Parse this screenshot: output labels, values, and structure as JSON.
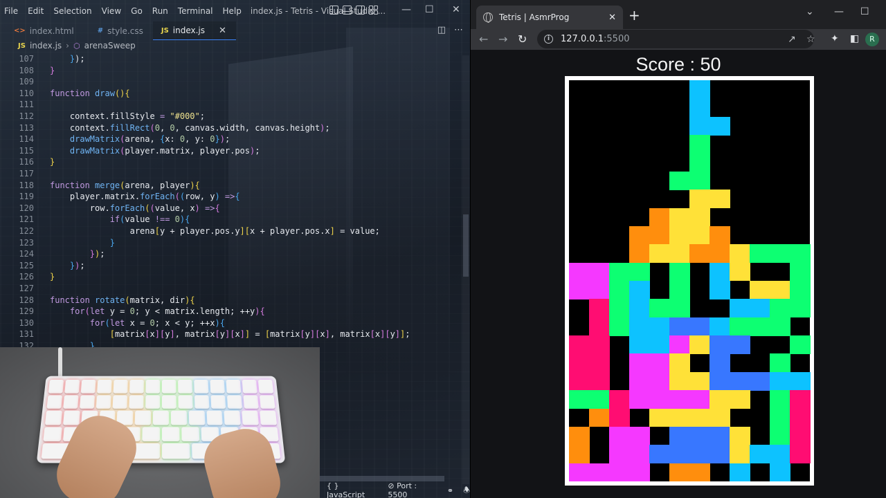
{
  "vscode": {
    "menu": [
      "File",
      "Edit",
      "Selection",
      "View",
      "Go",
      "Run",
      "Terminal",
      "Help"
    ],
    "window_title": "index.js - Tetris - Visual Studio ...",
    "tabs": [
      {
        "label": "index.html",
        "icon": "html-icon",
        "active": false
      },
      {
        "label": "style.css",
        "icon": "css-icon",
        "active": false
      },
      {
        "label": "index.js",
        "icon": "js-icon",
        "active": true
      }
    ],
    "breadcrumb": {
      "file": "index.js",
      "symbol": "arenaSweep"
    },
    "code_lines": [
      {
        "n": "107",
        "t": [
          [
            "i4",
            ""
          ],
          [
            "br3",
            "}"
          ],
          [
            "id",
            ");"
          ]
        ]
      },
      {
        "n": "108",
        "t": [
          [
            "br2",
            "}"
          ]
        ]
      },
      {
        "n": "109",
        "t": []
      },
      {
        "n": "110",
        "t": [
          [
            "kw",
            "function "
          ],
          [
            "fn",
            "draw"
          ],
          [
            "br1",
            "(){"
          ]
        ]
      },
      {
        "n": "111",
        "t": []
      },
      {
        "n": "112",
        "t": [
          [
            "i4",
            ""
          ],
          [
            "id",
            "context."
          ],
          [
            "prop",
            "fillStyle "
          ],
          [
            "op",
            "= "
          ],
          [
            "str",
            "\"#000\""
          ],
          [
            "id",
            ";"
          ]
        ]
      },
      {
        "n": "113",
        "t": [
          [
            "i4",
            ""
          ],
          [
            "id",
            "context."
          ],
          [
            "fn",
            "fillRect"
          ],
          [
            "br2",
            "("
          ],
          [
            "num",
            "0"
          ],
          [
            "id",
            ", "
          ],
          [
            "num",
            "0"
          ],
          [
            "id",
            ", canvas.width, canvas.height"
          ],
          [
            "br2",
            ")"
          ],
          [
            "id",
            ";"
          ]
        ]
      },
      {
        "n": "114",
        "t": [
          [
            "i4",
            ""
          ],
          [
            "fn",
            "drawMatrix"
          ],
          [
            "br2",
            "("
          ],
          [
            "id",
            "arena, "
          ],
          [
            "br3",
            "{"
          ],
          [
            "id",
            "x: "
          ],
          [
            "num",
            "0"
          ],
          [
            "id",
            ", y: "
          ],
          [
            "num",
            "0"
          ],
          [
            "br3",
            "}"
          ],
          [
            "br2",
            ")"
          ],
          [
            "id",
            ";"
          ]
        ]
      },
      {
        "n": "115",
        "t": [
          [
            "i4",
            ""
          ],
          [
            "fn",
            "drawMatrix"
          ],
          [
            "br2",
            "("
          ],
          [
            "id",
            "player.matrix, player.pos"
          ],
          [
            "br2",
            ")"
          ],
          [
            "id",
            ";"
          ]
        ]
      },
      {
        "n": "116",
        "t": [
          [
            "br1",
            "}"
          ]
        ]
      },
      {
        "n": "117",
        "t": []
      },
      {
        "n": "118",
        "t": [
          [
            "kw",
            "function "
          ],
          [
            "fn",
            "merge"
          ],
          [
            "br1",
            "("
          ],
          [
            "id",
            "arena, player"
          ],
          [
            "br1",
            ")"
          ],
          [
            "br1",
            "{"
          ]
        ]
      },
      {
        "n": "119",
        "t": [
          [
            "i4",
            ""
          ],
          [
            "id",
            "player.matrix."
          ],
          [
            "fn",
            "forEach"
          ],
          [
            "br2",
            "("
          ],
          [
            "br3",
            "("
          ],
          [
            "id",
            "row, y"
          ],
          [
            "br3",
            ")"
          ],
          [
            "kw",
            " =>"
          ],
          [
            "br3",
            "{"
          ]
        ]
      },
      {
        "n": "120",
        "t": [
          [
            "i8",
            ""
          ],
          [
            "id",
            "row."
          ],
          [
            "fn",
            "forEach"
          ],
          [
            "br1",
            "("
          ],
          [
            "br2",
            "("
          ],
          [
            "id",
            "value, x"
          ],
          [
            "br2",
            ")"
          ],
          [
            "kw",
            " =>"
          ],
          [
            "br2",
            "{"
          ]
        ]
      },
      {
        "n": "121",
        "t": [
          [
            "i12",
            ""
          ],
          [
            "kw",
            "if"
          ],
          [
            "br3",
            "("
          ],
          [
            "id",
            "value "
          ],
          [
            "op",
            "!== "
          ],
          [
            "num",
            "0"
          ],
          [
            "br3",
            ")"
          ],
          [
            "br3",
            "{"
          ]
        ]
      },
      {
        "n": "122",
        "t": [
          [
            "i16",
            ""
          ],
          [
            "id",
            "arena"
          ],
          [
            "br1",
            "["
          ],
          [
            "id",
            "y + player.pos.y"
          ],
          [
            "br1",
            "]"
          ],
          [
            "br1",
            "["
          ],
          [
            "id",
            "x + player.pos.x"
          ],
          [
            "br1",
            "]"
          ],
          [
            "id",
            " = value;"
          ]
        ]
      },
      {
        "n": "123",
        "t": [
          [
            "i12",
            ""
          ],
          [
            "br3",
            "}"
          ]
        ]
      },
      {
        "n": "124",
        "t": [
          [
            "i8",
            ""
          ],
          [
            "br2",
            "}"
          ],
          [
            "br1",
            ")"
          ],
          [
            "id",
            ";"
          ]
        ]
      },
      {
        "n": "125",
        "t": [
          [
            "i4",
            ""
          ],
          [
            "br3",
            "}"
          ],
          [
            "br2",
            ")"
          ],
          [
            "id",
            ";"
          ]
        ]
      },
      {
        "n": "126",
        "t": [
          [
            "br1",
            "}"
          ]
        ]
      },
      {
        "n": "127",
        "t": []
      },
      {
        "n": "128",
        "t": [
          [
            "kw",
            "function "
          ],
          [
            "fn",
            "rotate"
          ],
          [
            "br1",
            "("
          ],
          [
            "id",
            "matrix, dir"
          ],
          [
            "br1",
            ")"
          ],
          [
            "br1",
            "{"
          ]
        ]
      },
      {
        "n": "129",
        "t": [
          [
            "i4",
            ""
          ],
          [
            "kw",
            "for"
          ],
          [
            "br2",
            "("
          ],
          [
            "kw",
            "let "
          ],
          [
            "id",
            "y = "
          ],
          [
            "num",
            "0"
          ],
          [
            "id",
            "; y < matrix.length; ++y"
          ],
          [
            "br2",
            ")"
          ],
          [
            "br2",
            "{"
          ]
        ]
      },
      {
        "n": "130",
        "t": [
          [
            "i8",
            ""
          ],
          [
            "kw",
            "for"
          ],
          [
            "br3",
            "("
          ],
          [
            "kw",
            "let "
          ],
          [
            "id",
            "x = "
          ],
          [
            "num",
            "0"
          ],
          [
            "id",
            "; x < y; ++x"
          ],
          [
            "br3",
            ")"
          ],
          [
            "br3",
            "{"
          ]
        ]
      },
      {
        "n": "131",
        "t": [
          [
            "i12",
            ""
          ],
          [
            "br1",
            "["
          ],
          [
            "id",
            "matrix"
          ],
          [
            "br2",
            "["
          ],
          [
            "id",
            "x"
          ],
          [
            "br2",
            "]"
          ],
          [
            "br2",
            "["
          ],
          [
            "id",
            "y"
          ],
          [
            "br2",
            "]"
          ],
          [
            "id",
            ", matrix"
          ],
          [
            "br2",
            "["
          ],
          [
            "id",
            "y"
          ],
          [
            "br2",
            "]"
          ],
          [
            "br2",
            "["
          ],
          [
            "id",
            "x"
          ],
          [
            "br2",
            "]"
          ],
          [
            "br1",
            "]"
          ],
          [
            "id",
            " = "
          ],
          [
            "br1",
            "["
          ],
          [
            "id",
            "matrix"
          ],
          [
            "br2",
            "["
          ],
          [
            "id",
            "y"
          ],
          [
            "br2",
            "]"
          ],
          [
            "br2",
            "["
          ],
          [
            "id",
            "x"
          ],
          [
            "br2",
            "]"
          ],
          [
            "id",
            ", matrix"
          ],
          [
            "br2",
            "["
          ],
          [
            "id",
            "x"
          ],
          [
            "br2",
            "]"
          ],
          [
            "br2",
            "["
          ],
          [
            "id",
            "y"
          ],
          [
            "br2",
            "]"
          ],
          [
            "br1",
            "]"
          ],
          [
            "id",
            ";"
          ]
        ]
      },
      {
        "n": "132",
        "t": [
          [
            "i8",
            ""
          ],
          [
            "br3",
            "}"
          ]
        ]
      }
    ],
    "status": {
      "language": "JavaScript",
      "port": "Port : 5500"
    }
  },
  "browser": {
    "tab_title": "Tetris | AsmrProg",
    "url_host": "127.0.0.1",
    "url_port": ":5500",
    "profile_initial": "R",
    "score_text": "Score : 50",
    "colors": {
      "O": "#FF0D72",
      "C": "#0DC2FF",
      "G": "#0DFF72",
      "M": "#F538FF",
      "R": "#FF8E0D",
      "Y": "#FFE138",
      "B": "#3877FF"
    },
    "board_rows": [
      "......C.....",
      "......C.....",
      "......CC....",
      "......G.....",
      "......G.....",
      ".....GG.....",
      "......YY....",
      "....RYY.....",
      "...RRYYR....",
      "...RYYRRYGGG",
      "MMGG.G.CY..G",
      "MMGC.G.C.YYG",
      ".OGCGG..CCGG",
      ".OGCCBBCGGG.",
      "OO.CCMYBB..G",
      "OO.MMY.B..G.",
      "OO.MMYYBBBCC",
      "GGOMMMMYY.GO",
      ".RO.YYYY..GO",
      "R.MM.BBBY.GO",
      "R.MMBBBBYCCO",
      "MMMM.RR.C.C."
    ]
  }
}
